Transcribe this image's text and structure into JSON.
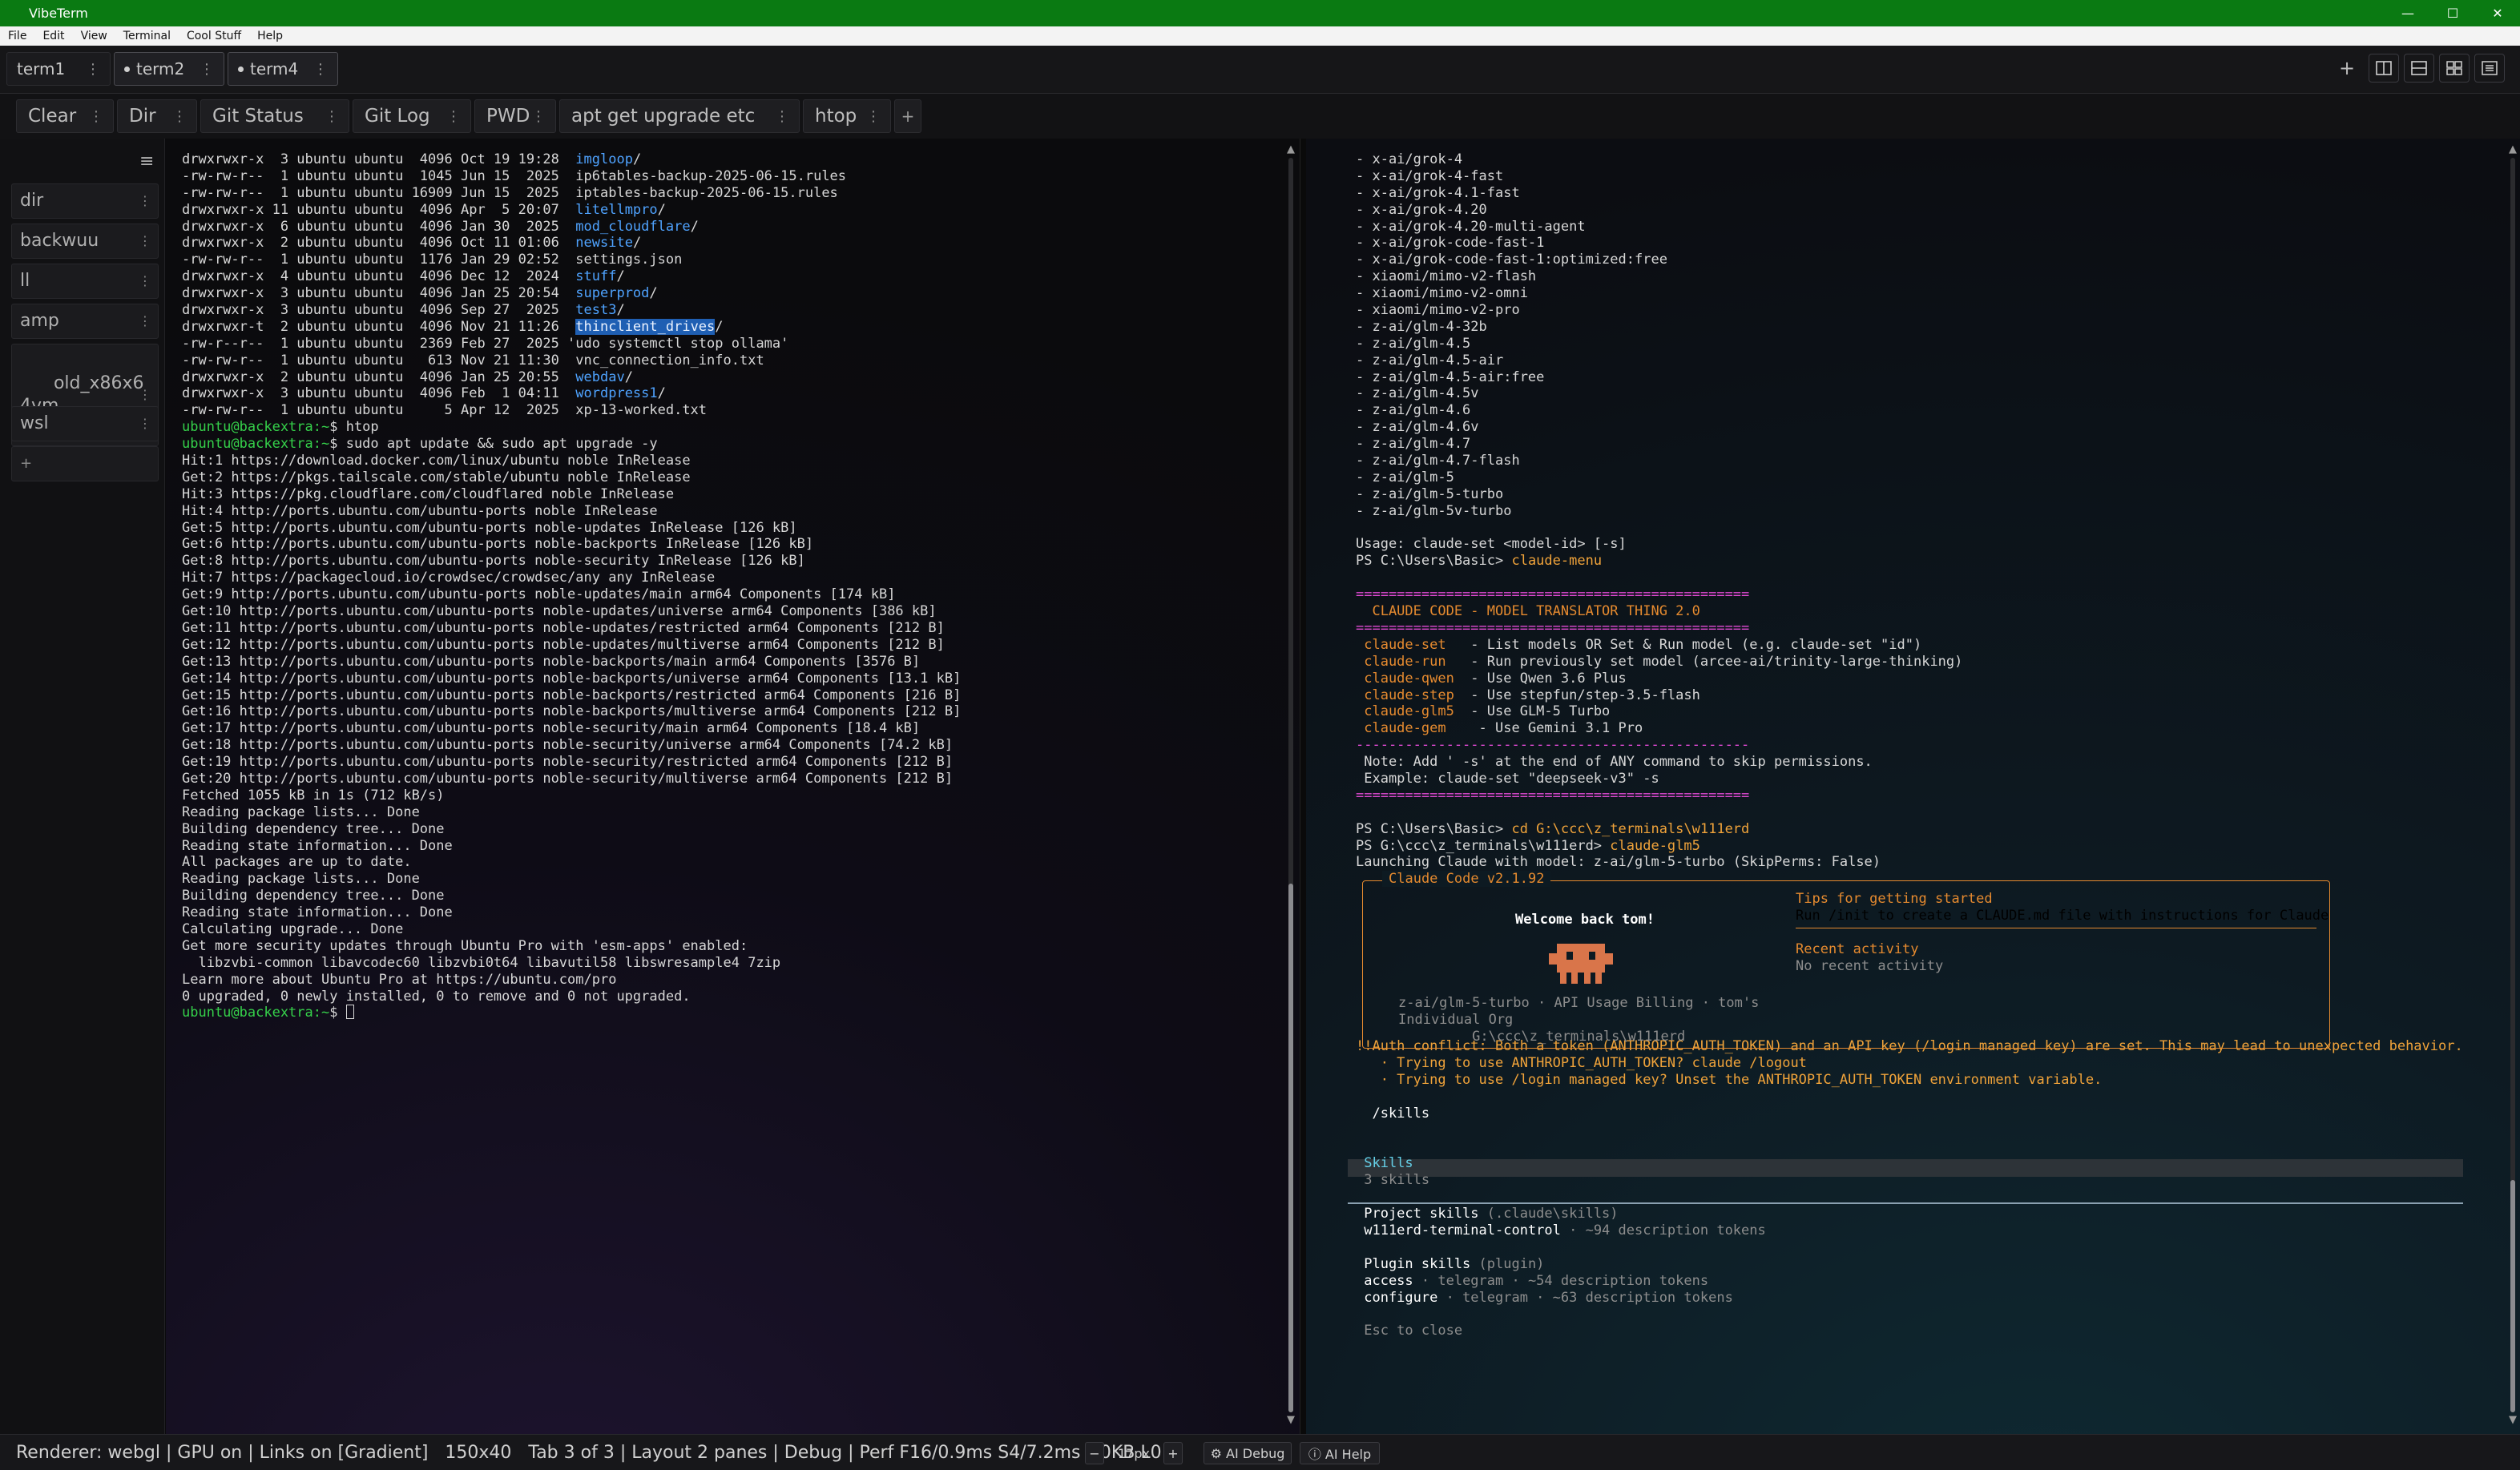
{
  "window": {
    "title": "VibeTerm",
    "controls": [
      "—",
      "☐",
      "✕"
    ]
  },
  "menu": [
    "File",
    "Edit",
    "View",
    "Terminal",
    "Cool Stuff",
    "Help"
  ],
  "tabs": [
    {
      "label": "term1",
      "active": false,
      "modified": false
    },
    {
      "label": "term2",
      "active": true,
      "modified": true
    },
    {
      "label": "term4",
      "active": true,
      "modified": true
    }
  ],
  "quick_commands": [
    "Clear",
    "Dir",
    "Git Status",
    "Git Log",
    "PWD",
    "apt get upgrade etc",
    "htop"
  ],
  "quick_add": "+",
  "sidebar": {
    "items": [
      "dir",
      "backwuu",
      "ll",
      "amp",
      "old_x86x6\n4vm",
      "wsl"
    ],
    "add": "+"
  },
  "left_terminal": {
    "lines": [
      [
        {
          "t": "drwxrwxr-x  3 ubuntu ubuntu  4096 Oct 19 19:28  "
        },
        {
          "t": "imgloop",
          "c": "blue"
        },
        {
          "t": "/"
        }
      ],
      [
        {
          "t": "-rw-rw-r--  1 ubuntu ubuntu  1045 Jun 15  2025  ip6tables-backup-2025-06-15.rules"
        }
      ],
      [
        {
          "t": "-rw-rw-r--  1 ubuntu ubuntu 16909 Jun 15  2025  iptables-backup-2025-06-15.rules"
        }
      ],
      [
        {
          "t": "drwxrwxr-x 11 ubuntu ubuntu  4096 Apr  5 20:07  "
        },
        {
          "t": "litellmpro",
          "c": "blue"
        },
        {
          "t": "/"
        }
      ],
      [
        {
          "t": "drwxrwxr-x  6 ubuntu ubuntu  4096 Jan 30  2025  "
        },
        {
          "t": "mod_cloudflare",
          "c": "blue"
        },
        {
          "t": "/"
        }
      ],
      [
        {
          "t": "drwxrwxr-x  2 ubuntu ubuntu  4096 Oct 11 01:06  "
        },
        {
          "t": "newsite",
          "c": "blue"
        },
        {
          "t": "/"
        }
      ],
      [
        {
          "t": "-rw-rw-r--  1 ubuntu ubuntu  1176 Jan 29 02:52  settings.json"
        }
      ],
      [
        {
          "t": "drwxrwxr-x  4 ubuntu ubuntu  4096 Dec 12  2024  "
        },
        {
          "t": "stuff",
          "c": "blue"
        },
        {
          "t": "/"
        }
      ],
      [
        {
          "t": "drwxrwxr-x  3 ubuntu ubuntu  4096 Jan 25 20:54  "
        },
        {
          "t": "superprod",
          "c": "blue"
        },
        {
          "t": "/"
        }
      ],
      [
        {
          "t": "drwxrwxr-x  3 ubuntu ubuntu  4096 Sep 27  2025  "
        },
        {
          "t": "test3",
          "c": "blue"
        },
        {
          "t": "/"
        }
      ],
      [
        {
          "t": "drwxrwxr-t  2 ubuntu ubuntu  4096 Nov 21 11:26  "
        },
        {
          "t": "thinclient_drives",
          "c": "hl"
        },
        {
          "t": "/"
        }
      ],
      [
        {
          "t": "-rw-r--r--  1 ubuntu ubuntu  2369 Feb 27  2025 'udo systemctl stop ollama'"
        }
      ],
      [
        {
          "t": "-rw-rw-r--  1 ubuntu ubuntu   613 Nov 21 11:30  vnc_connection_info.txt"
        }
      ],
      [
        {
          "t": "drwxrwxr-x  2 ubuntu ubuntu  4096 Jan 25 20:55  "
        },
        {
          "t": "webdav",
          "c": "blue"
        },
        {
          "t": "/"
        }
      ],
      [
        {
          "t": "drwxrwxr-x  3 ubuntu ubuntu  4096 Feb  1 04:11  "
        },
        {
          "t": "wordpress1",
          "c": "blue"
        },
        {
          "t": "/"
        }
      ],
      [
        {
          "t": "-rw-rw-r--  1 ubuntu ubuntu     5 Apr 12  2025  xp-13-worked.txt"
        }
      ],
      [
        {
          "t": "ubuntu@backextra:~",
          "c": "green"
        },
        {
          "t": "$ htop"
        }
      ],
      [
        {
          "t": "ubuntu@backextra:~",
          "c": "green"
        },
        {
          "t": "$ sudo apt update && sudo apt upgrade -y"
        }
      ],
      [
        {
          "t": "Hit:1 https://download.docker.com/linux/ubuntu noble InRelease"
        }
      ],
      [
        {
          "t": "Get:2 https://pkgs.tailscale.com/stable/ubuntu noble InRelease"
        }
      ],
      [
        {
          "t": "Hit:3 https://pkg.cloudflare.com/cloudflared noble InRelease"
        }
      ],
      [
        {
          "t": "Hit:4 http://ports.ubuntu.com/ubuntu-ports noble InRelease"
        }
      ],
      [
        {
          "t": "Get:5 http://ports.ubuntu.com/ubuntu-ports noble-updates InRelease [126 kB]"
        }
      ],
      [
        {
          "t": "Get:6 http://ports.ubuntu.com/ubuntu-ports noble-backports InRelease [126 kB]"
        }
      ],
      [
        {
          "t": "Get:8 http://ports.ubuntu.com/ubuntu-ports noble-security InRelease [126 kB]"
        }
      ],
      [
        {
          "t": "Hit:7 https://packagecloud.io/crowdsec/crowdsec/any any InRelease"
        }
      ],
      [
        {
          "t": "Get:9 http://ports.ubuntu.com/ubuntu-ports noble-updates/main arm64 Components [174 kB]"
        }
      ],
      [
        {
          "t": "Get:10 http://ports.ubuntu.com/ubuntu-ports noble-updates/universe arm64 Components [386 kB]"
        }
      ],
      [
        {
          "t": "Get:11 http://ports.ubuntu.com/ubuntu-ports noble-updates/restricted arm64 Components [212 B]"
        }
      ],
      [
        {
          "t": "Get:12 http://ports.ubuntu.com/ubuntu-ports noble-updates/multiverse arm64 Components [212 B]"
        }
      ],
      [
        {
          "t": "Get:13 http://ports.ubuntu.com/ubuntu-ports noble-backports/main arm64 Components [3576 B]"
        }
      ],
      [
        {
          "t": "Get:14 http://ports.ubuntu.com/ubuntu-ports noble-backports/universe arm64 Components [13.1 kB]"
        }
      ],
      [
        {
          "t": "Get:15 http://ports.ubuntu.com/ubuntu-ports noble-backports/restricted arm64 Components [216 B]"
        }
      ],
      [
        {
          "t": "Get:16 http://ports.ubuntu.com/ubuntu-ports noble-backports/multiverse arm64 Components [212 B]"
        }
      ],
      [
        {
          "t": "Get:17 http://ports.ubuntu.com/ubuntu-ports noble-security/main arm64 Components [18.4 kB]"
        }
      ],
      [
        {
          "t": "Get:18 http://ports.ubuntu.com/ubuntu-ports noble-security/universe arm64 Components [74.2 kB]"
        }
      ],
      [
        {
          "t": "Get:19 http://ports.ubuntu.com/ubuntu-ports noble-security/restricted arm64 Components [212 B]"
        }
      ],
      [
        {
          "t": "Get:20 http://ports.ubuntu.com/ubuntu-ports noble-security/multiverse arm64 Components [212 B]"
        }
      ],
      [
        {
          "t": "Fetched 1055 kB in 1s (712 kB/s)"
        }
      ],
      [
        {
          "t": "Reading package lists... Done"
        }
      ],
      [
        {
          "t": "Building dependency tree... Done"
        }
      ],
      [
        {
          "t": "Reading state information... Done"
        }
      ],
      [
        {
          "t": "All packages are up to date."
        }
      ],
      [
        {
          "t": "Reading package lists... Done"
        }
      ],
      [
        {
          "t": "Building dependency tree... Done"
        }
      ],
      [
        {
          "t": "Reading state information... Done"
        }
      ],
      [
        {
          "t": "Calculating upgrade... Done"
        }
      ],
      [
        {
          "t": "Get more security updates through Ubuntu Pro with 'esm-apps' enabled:"
        }
      ],
      [
        {
          "t": "  libzvbi-common libavcodec60 libzvbi0t64 libavutil58 libswresample4 7zip"
        }
      ],
      [
        {
          "t": "Learn more about Ubuntu Pro at https://ubuntu.com/pro"
        }
      ],
      [
        {
          "t": "0 upgraded, 0 newly installed, 0 to remove and 0 not upgraded."
        }
      ],
      [
        {
          "t": "ubuntu@backextra:~",
          "c": "green"
        },
        {
          "t": "$ "
        },
        {
          "cursor": true
        }
      ]
    ]
  },
  "right_terminal": {
    "lines": [
      [
        {
          "t": "- x-ai/grok-4"
        }
      ],
      [
        {
          "t": "- x-ai/grok-4-fast"
        }
      ],
      [
        {
          "t": "- x-ai/grok-4.1-fast"
        }
      ],
      [
        {
          "t": "- x-ai/grok-4.20"
        }
      ],
      [
        {
          "t": "- x-ai/grok-4.20-multi-agent"
        }
      ],
      [
        {
          "t": "- x-ai/grok-code-fast-1"
        }
      ],
      [
        {
          "t": "- x-ai/grok-code-fast-1:optimized:free"
        }
      ],
      [
        {
          "t": "- xiaomi/mimo-v2-flash"
        }
      ],
      [
        {
          "t": "- xiaomi/mimo-v2-omni"
        }
      ],
      [
        {
          "t": "- xiaomi/mimo-v2-pro"
        }
      ],
      [
        {
          "t": "- z-ai/glm-4-32b"
        }
      ],
      [
        {
          "t": "- z-ai/glm-4.5"
        }
      ],
      [
        {
          "t": "- z-ai/glm-4.5-air"
        }
      ],
      [
        {
          "t": "- z-ai/glm-4.5-air:free"
        }
      ],
      [
        {
          "t": "- z-ai/glm-4.5v"
        }
      ],
      [
        {
          "t": "- z-ai/glm-4.6"
        }
      ],
      [
        {
          "t": "- z-ai/glm-4.6v"
        }
      ],
      [
        {
          "t": "- z-ai/glm-4.7"
        }
      ],
      [
        {
          "t": "- z-ai/glm-4.7-flash"
        }
      ],
      [
        {
          "t": "- z-ai/glm-5"
        }
      ],
      [
        {
          "t": "- z-ai/glm-5-turbo"
        }
      ],
      [
        {
          "t": "- z-ai/glm-5v-turbo"
        }
      ],
      [
        {
          "t": ""
        }
      ],
      [
        {
          "t": "Usage: claude-set <model-id> [-s]"
        }
      ],
      [
        {
          "t": "PS C:\\Users\\Basic> "
        },
        {
          "t": "claude-menu",
          "c": "orangeb"
        }
      ],
      [
        {
          "t": ""
        }
      ],
      [
        {
          "t": "================================================",
          "c": "pink"
        }
      ],
      [
        {
          "t": "  CLAUDE CODE - MODEL TRANSLATOR THING 2.0",
          "c": "orange"
        }
      ],
      [
        {
          "t": "================================================",
          "c": "pink"
        }
      ],
      [
        {
          "t": " claude-set ",
          "c": "orange"
        },
        {
          "t": "  - List models OR Set & Run model (e.g. claude-set \"id\")"
        }
      ],
      [
        {
          "t": " claude-run ",
          "c": "orange"
        },
        {
          "t": "  - Run previously set model (arcee-ai/trinity-large-thinking)"
        }
      ],
      [
        {
          "t": " claude-qwen",
          "c": "orange"
        },
        {
          "t": "  - Use Qwen 3.6 Plus"
        }
      ],
      [
        {
          "t": " claude-step",
          "c": "orange"
        },
        {
          "t": "  - Use stepfun/step-3.5-flash"
        }
      ],
      [
        {
          "t": " claude-glm5",
          "c": "orange"
        },
        {
          "t": "  - Use GLM-5 Turbo"
        }
      ],
      [
        {
          "t": " claude-gem ",
          "c": "orange"
        },
        {
          "t": "   - Use Gemini 3.1 Pro"
        }
      ],
      [
        {
          "t": "------------------------------------------------",
          "c": "pink"
        }
      ],
      [
        {
          "t": " Note: Add ' -s' at the end of ANY command to skip permissions."
        }
      ],
      [
        {
          "t": " Example: claude-set \"deepseek-v3\" -s"
        }
      ],
      [
        {
          "t": "================================================",
          "c": "pink"
        }
      ],
      [
        {
          "t": ""
        }
      ],
      [
        {
          "t": "PS C:\\Users\\Basic> "
        },
        {
          "t": "cd G:\\ccc\\z_terminals\\w111erd",
          "c": "orangeb"
        }
      ],
      [
        {
          "t": "PS G:\\ccc\\z_terminals\\w111erd> "
        },
        {
          "t": "claude-glm5",
          "c": "orangeb"
        }
      ],
      [
        {
          "t": "Launching Claude with model: z-ai/glm-5-turbo (SkipPerms: False)"
        }
      ],
      [
        {
          "t": ""
        }
      ],
      [
        {
          "t": ""
        }
      ],
      [
        {
          "t": ""
        }
      ],
      [
        {
          "t": ""
        }
      ],
      [
        {
          "t": ""
        }
      ],
      [
        {
          "t": ""
        }
      ],
      [
        {
          "t": ""
        }
      ],
      [
        {
          "t": ""
        }
      ],
      [
        {
          "t": ""
        }
      ],
      [
        {
          "t": ""
        }
      ],
      [
        {
          "t": "!!Auth conflict: Both a token (ANTHROPIC_AUTH_TOKEN) and an API key (/login managed key) are set. This may lead to unexpected behavior.",
          "c": "orangeb"
        }
      ],
      [
        {
          "t": "   · Trying to use ANTHROPIC_AUTH_TOKEN? claude /logout",
          "c": "orangeb"
        }
      ],
      [
        {
          "t": "   · Trying to use /login managed key? Unset the ANTHROPIC_AUTH_TOKEN environment variable.",
          "c": "orangeb"
        }
      ],
      [
        {
          "t": ""
        }
      ],
      [
        {
          "t": "  /skills",
          "c": "white"
        }
      ],
      [
        {
          "t": ""
        }
      ],
      [
        {
          "t": ""
        }
      ],
      [
        {
          "t": " Skills",
          "c": "cyan"
        }
      ],
      [
        {
          "t": " 3 skills",
          "c": "grey"
        }
      ],
      [
        {
          "t": ""
        }
      ],
      [
        {
          "t": " Project skills ",
          "c": "white"
        },
        {
          "t": "(.claude\\skills)",
          "c": "grey"
        }
      ],
      [
        {
          "t": " w111erd-terminal-control",
          "c": "white"
        },
        {
          "t": " · ~94 description tokens",
          "c": "grey"
        }
      ],
      [
        {
          "t": ""
        }
      ],
      [
        {
          "t": " Plugin skills ",
          "c": "white"
        },
        {
          "t": "(plugin)",
          "c": "grey"
        }
      ],
      [
        {
          "t": " access",
          "c": "white"
        },
        {
          "t": " · telegram · ~54 description tokens",
          "c": "grey"
        }
      ],
      [
        {
          "t": " configure",
          "c": "white"
        },
        {
          "t": " · telegram · ~63 description tokens",
          "c": "grey"
        }
      ],
      [
        {
          "t": ""
        }
      ],
      [
        {
          "t": " Esc to close",
          "c": "grey"
        }
      ]
    ]
  },
  "claude_box": {
    "title": "Claude Code v2.1.92",
    "welcome": "Welcome back tom!",
    "info": [
      "z-ai/glm-5-turbo · API Usage Billing · tom's",
      "Individual Org",
      "         G:\\ccc\\z_terminals\\w111erd"
    ],
    "tips_title": "Tips for getting started",
    "tips_text": "Run /init to create a CLAUDE.md file with instructions for Claude",
    "recent_title": "Recent activity",
    "recent_text": "No recent activity",
    "accent": "#e58a2f"
  },
  "status": {
    "text": "Renderer: webgl | GPU on | Links on [Gradient]   150x40   Tab 3 of 3 | Layout 2 panes | Debug | Perf F16/0.9ms S4/7.2ms O0KB L0",
    "font_size": "17px",
    "minus": "−",
    "plus": "+",
    "ai_debug": "⚙ AI Debug",
    "ai_help": "ⓘ AI Help"
  },
  "colors": {
    "titlebar": "#0a7a12",
    "prompt_green": "#35d04a",
    "dir_blue": "#4fa3ff",
    "accent_orange": "#e58a2f",
    "banner_pink": "#e14ad4"
  }
}
